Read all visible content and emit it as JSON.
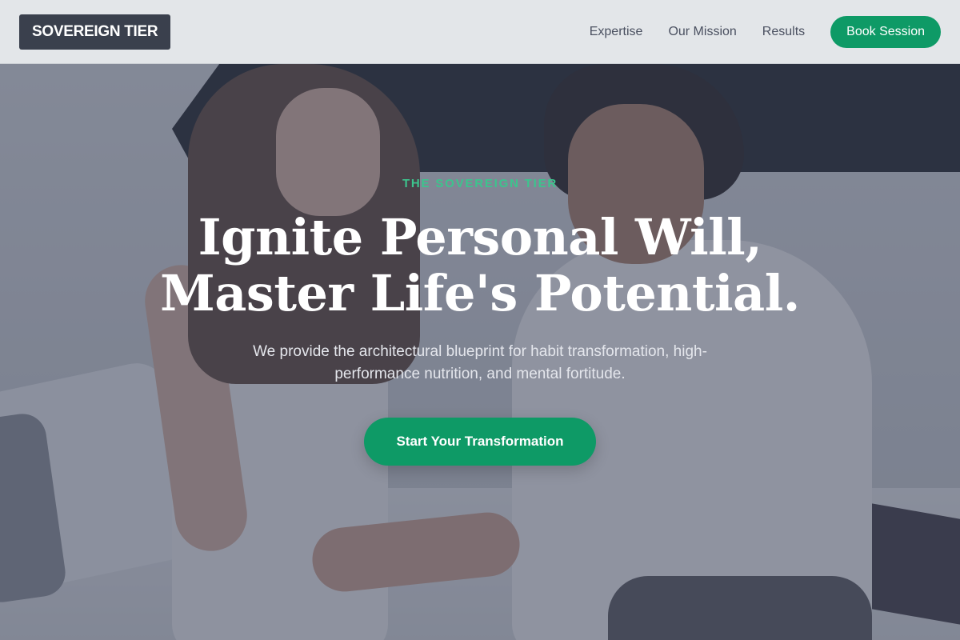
{
  "brand": {
    "logo_text": "SOVEREIGN TIER"
  },
  "nav": {
    "links": [
      {
        "label": "Expertise"
      },
      {
        "label": "Our Mission"
      },
      {
        "label": "Results"
      }
    ],
    "cta_label": "Book Session"
  },
  "hero": {
    "eyebrow": "THE SOVEREIGN TIER",
    "headline_line1": "Ignite Personal Will,",
    "headline_line2": "Master Life's Potential.",
    "subtext": "We provide the architectural blueprint for habit transformation, high-performance nutrition, and mental fortitude.",
    "cta_label": "Start Your Transformation"
  },
  "colors": {
    "accent": "#0e9a66",
    "eyebrow": "#3cc48d",
    "logo_bg": "#3a404d",
    "overlay": "#3a4258"
  }
}
